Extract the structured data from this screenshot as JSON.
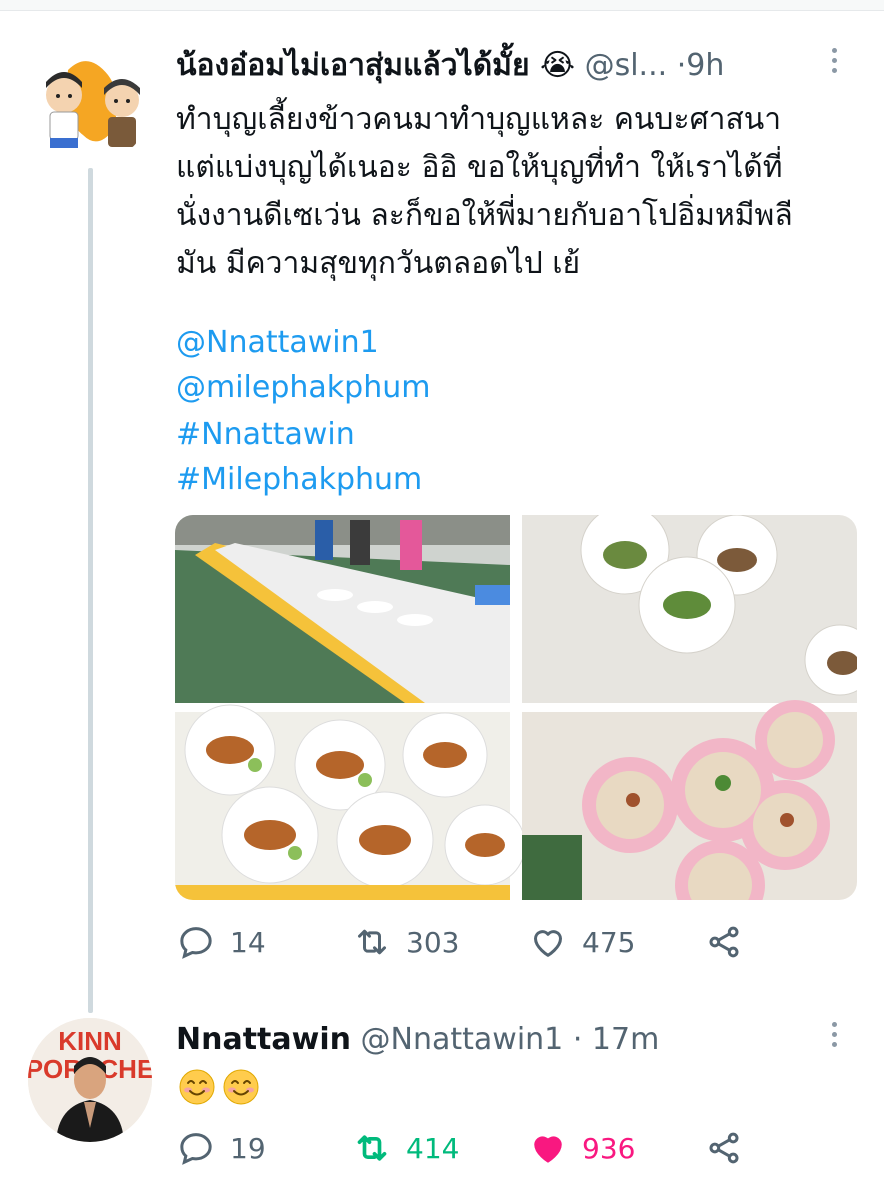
{
  "tweet": {
    "author_name": "น้องอ๋อมไม่เอาสุ่มแล้วได้มั้ย 😭",
    "author_handle": "@sl...",
    "separator": "·",
    "time": "9h",
    "text": "ทำบุญเลี้ยงข้าวคนมาทำบุญแหละ คนบะศาสนา\nแต่แบ่งบุญได้เนอะ อิอิ ขอให้บุญที่ทำ ให้เราได้ที่\nนั่งงานดีเซเว่น ละก็ขอให้พี่มายกับอาโปอิ่มหมีพลี\nมัน มีความสุขทุกวันตลอดไป เย้",
    "mentions": [
      "@Nnattawin1",
      "@milephakphum",
      "#Nnattawin",
      "#Milephakphum"
    ],
    "stats": {
      "replies": "14",
      "retweets": "303",
      "likes": "475"
    }
  },
  "reply": {
    "author_name": "Nnattawin",
    "author_handle": "@Nnattawin1",
    "separator": "·",
    "time": "17m",
    "emoji": "😊😊",
    "avatar_text_1": "KINN",
    "avatar_text_2": "PORSCHE",
    "stats": {
      "replies": "19",
      "retweets": "414",
      "likes": "936"
    }
  },
  "colors": {
    "link": "#1d9bf0",
    "muted": "#536471",
    "retweet_active": "#00ba7c",
    "like_active": "#f91880"
  },
  "icons": [
    "reply-icon",
    "retweet-icon",
    "like-icon",
    "share-icon",
    "more-icon"
  ]
}
